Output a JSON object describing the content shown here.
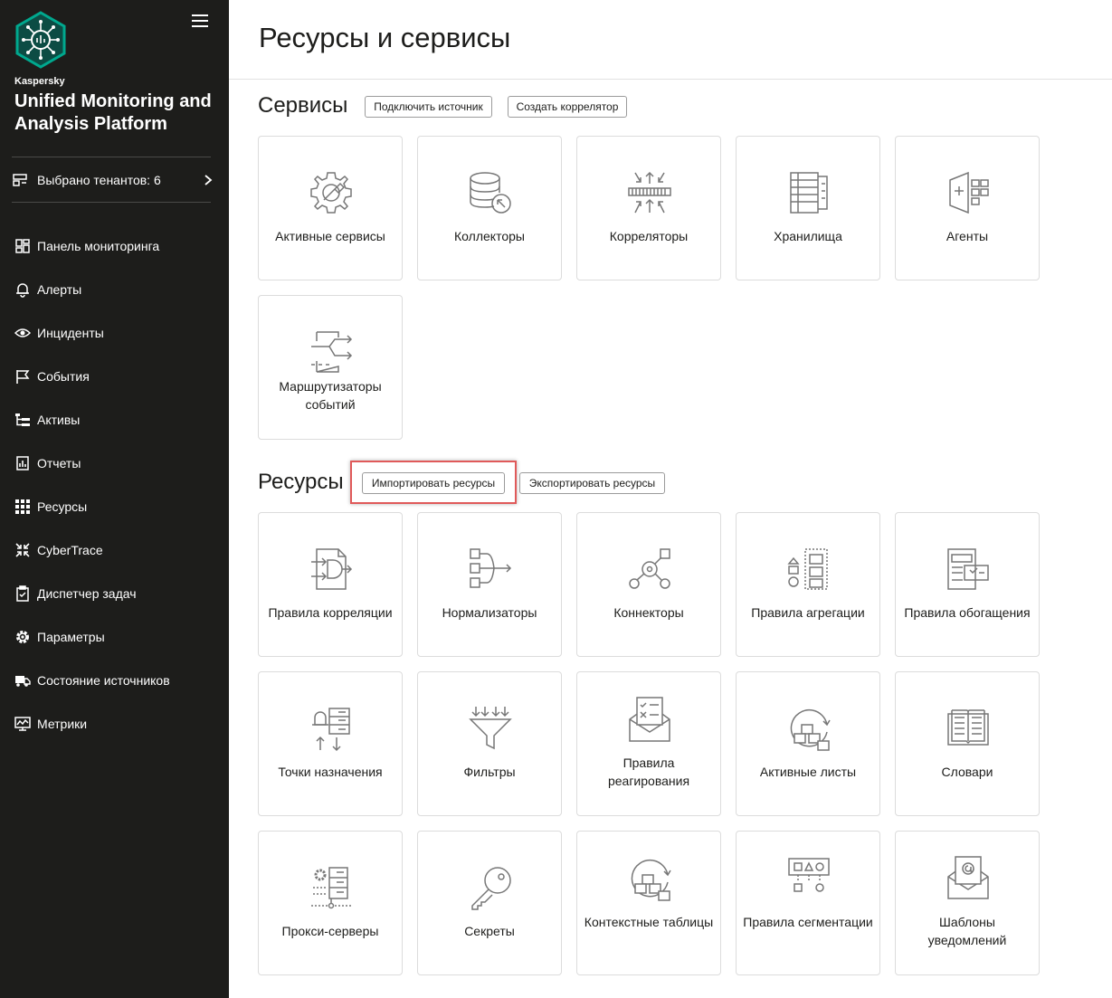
{
  "sidebar": {
    "brand_small": "Kaspersky",
    "brand_title": "Unified Monitoring and Analysis Platform",
    "tenant_label": "Выбрано тенантов: 6",
    "items": [
      {
        "label": "Панель мониторинга",
        "icon": "dashboard-icon"
      },
      {
        "label": "Алерты",
        "icon": "bell-icon"
      },
      {
        "label": "Инциденты",
        "icon": "eye-icon"
      },
      {
        "label": "События",
        "icon": "flag-icon"
      },
      {
        "label": "Активы",
        "icon": "tree-icon"
      },
      {
        "label": "Отчеты",
        "icon": "report-icon"
      },
      {
        "label": "Ресурсы",
        "icon": "grid-icon"
      },
      {
        "label": "CyberTrace",
        "icon": "arrows-in-icon"
      },
      {
        "label": "Диспетчер задач",
        "icon": "clipboard-icon"
      },
      {
        "label": "Параметры",
        "icon": "gear-icon"
      },
      {
        "label": "Состояние источников",
        "icon": "truck-icon"
      },
      {
        "label": "Метрики",
        "icon": "monitor-icon"
      }
    ]
  },
  "page_title": "Ресурсы и сервисы",
  "services": {
    "title": "Сервисы",
    "buttons": [
      "Подключить источник",
      "Создать коррелятор"
    ],
    "tiles": [
      "Активные сервисы",
      "Коллекторы",
      "Корреляторы",
      "Хранилища",
      "Агенты",
      "Маршрутизаторы событий"
    ]
  },
  "resources": {
    "title": "Ресурсы",
    "buttons": [
      "Импортировать ресурсы",
      "Экспортировать ресурсы"
    ],
    "tiles": [
      "Правила корреляции",
      "Нормализаторы",
      "Коннекторы",
      "Правила агрегации",
      "Правила обогащения",
      "Точки назначения",
      "Фильтры",
      "Правила реагирования",
      "Активные листы",
      "Словари",
      "Прокси-серверы",
      "Секреты",
      "Контекстные таблицы",
      "Правила сегментации",
      "Шаблоны уведомлений"
    ]
  },
  "colors": {
    "sidebar_bg": "#1d1d1b",
    "accent": "#00a88e",
    "highlight": "#e05a5a"
  }
}
